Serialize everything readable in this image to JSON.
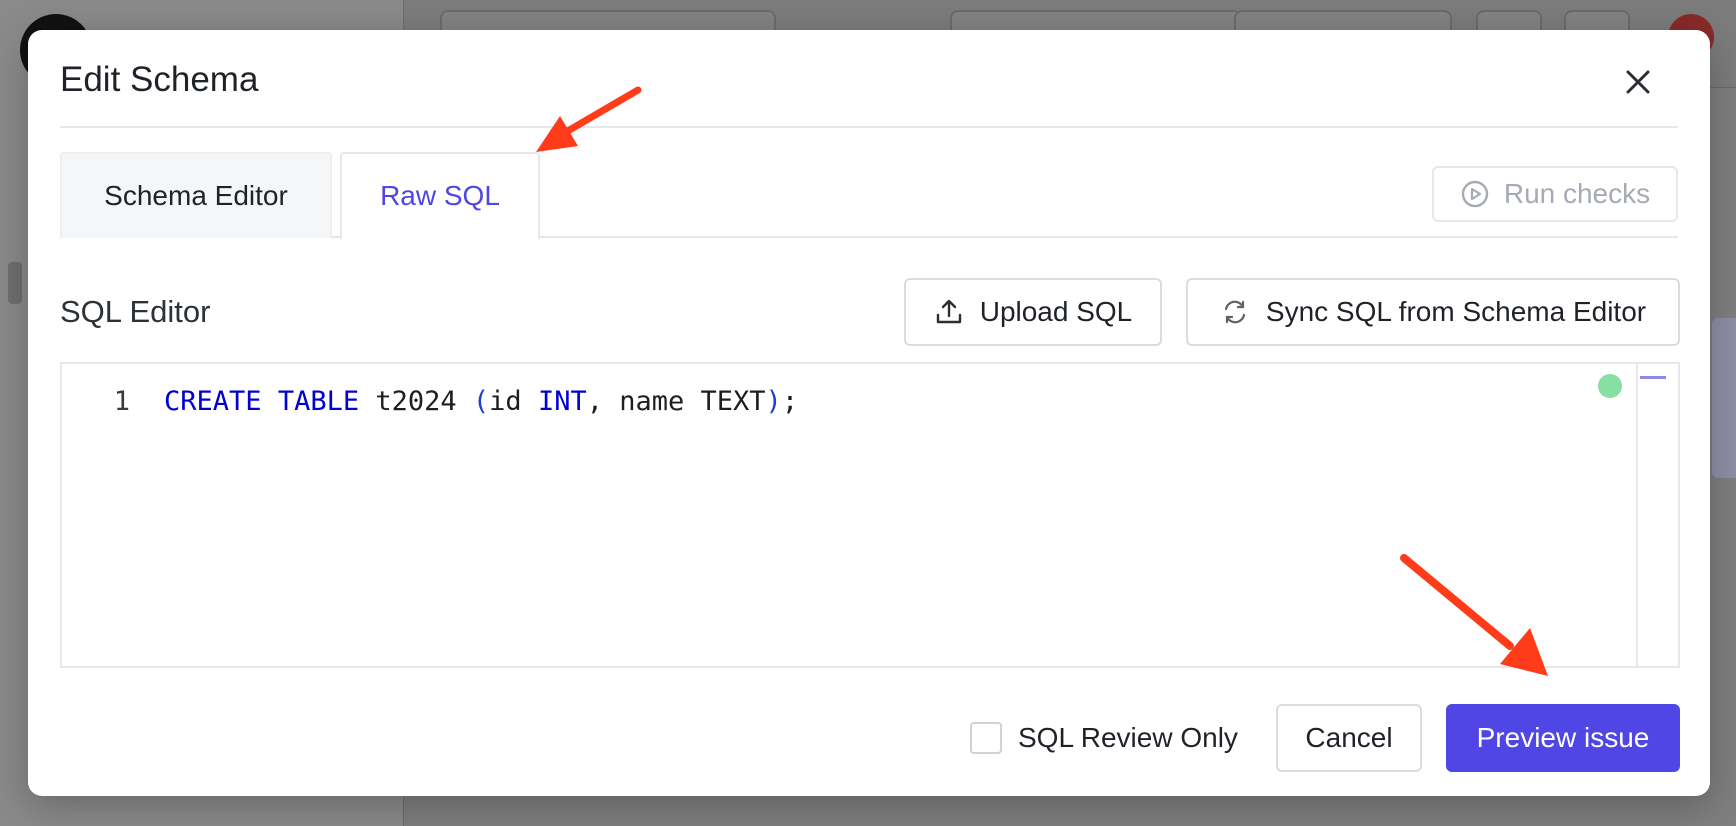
{
  "modal": {
    "title": "Edit Schema"
  },
  "tabs": [
    {
      "label": "Schema Editor",
      "active": false
    },
    {
      "label": "Raw SQL",
      "active": true
    }
  ],
  "run_checks": {
    "label": "Run checks",
    "icon": "play-circle-icon",
    "disabled": true
  },
  "sql_editor": {
    "label": "SQL Editor",
    "upload_label": "Upload SQL",
    "sync_label": "Sync SQL from Schema Editor",
    "line_number": "1",
    "code": {
      "create": "CREATE",
      "table": "TABLE",
      "name": "t2024",
      "open_paren": "(",
      "col1": "id",
      "int": "INT",
      "col2_def": ", name TEXT",
      "close_paren": ")",
      "end": ";"
    },
    "status": "ok"
  },
  "footer": {
    "review_only_label": "SQL Review Only",
    "review_only_checked": false,
    "cancel_label": "Cancel",
    "preview_label": "Preview issue"
  },
  "colors": {
    "accent": "#4f46e5",
    "annotation_arrow": "#ff3b1a",
    "keyword": "#0000d0",
    "status_dot": "#86e0a3"
  }
}
